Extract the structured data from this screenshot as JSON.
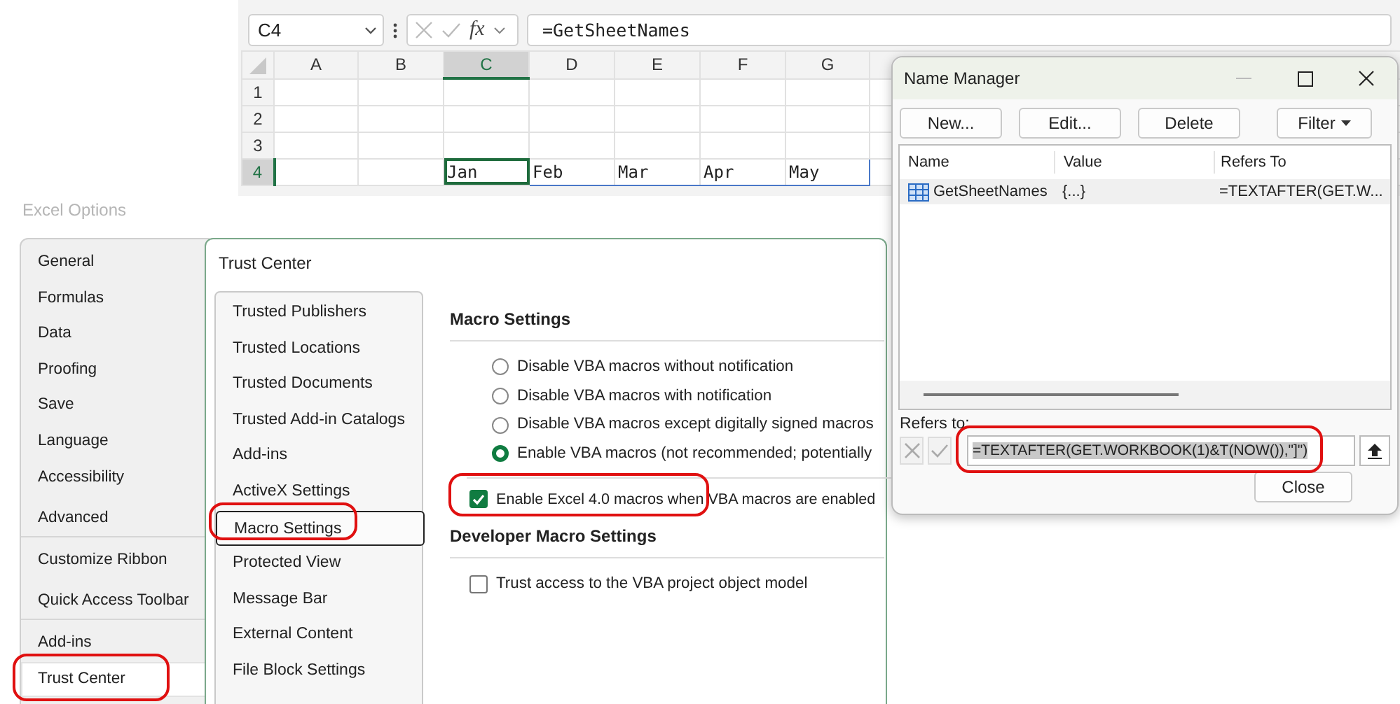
{
  "formula_bar": {
    "name_box": "C4",
    "function_label": "fx",
    "formula": "=GetSheetNames"
  },
  "sheet": {
    "columns": [
      {
        "label": "A",
        "selected": false
      },
      {
        "label": "B",
        "selected": false
      },
      {
        "label": "C",
        "selected": true
      },
      {
        "label": "D",
        "selected": false
      },
      {
        "label": "E",
        "selected": false
      },
      {
        "label": "F",
        "selected": false
      },
      {
        "label": "G",
        "selected": false
      }
    ],
    "rows": [
      {
        "label": "1",
        "selected": false,
        "cells": [
          null,
          null,
          null,
          null,
          null,
          null,
          null
        ]
      },
      {
        "label": "2",
        "selected": false,
        "cells": [
          null,
          null,
          null,
          null,
          null,
          null,
          null
        ]
      },
      {
        "label": "3",
        "selected": false,
        "cells": [
          null,
          null,
          null,
          null,
          null,
          null,
          null
        ]
      },
      {
        "label": "4",
        "selected": true,
        "cells": [
          null,
          null,
          {
            "text": "Jan",
            "active": true
          },
          {
            "text": "Feb",
            "active": false
          },
          {
            "text": "Mar",
            "active": false
          },
          {
            "text": "Apr",
            "active": false
          },
          {
            "text": "May",
            "active": false
          }
        ]
      }
    ]
  },
  "excel_options": {
    "title": "Excel Options",
    "categories": [
      {
        "label": "General",
        "selected": false,
        "highlighted": false,
        "divider_after": false
      },
      {
        "label": "Formulas",
        "selected": false,
        "highlighted": false,
        "divider_after": false
      },
      {
        "label": "Data",
        "selected": false,
        "highlighted": false,
        "divider_after": false
      },
      {
        "label": "Proofing",
        "selected": false,
        "highlighted": false,
        "divider_after": false
      },
      {
        "label": "Save",
        "selected": false,
        "highlighted": false,
        "divider_after": false
      },
      {
        "label": "Language",
        "selected": false,
        "highlighted": false,
        "divider_after": false
      },
      {
        "label": "Accessibility",
        "selected": false,
        "highlighted": false,
        "divider_after": false
      },
      {
        "label": "Advanced",
        "selected": false,
        "highlighted": false,
        "divider_after": true
      },
      {
        "label": "Customize Ribbon",
        "selected": false,
        "highlighted": false,
        "divider_after": false
      },
      {
        "label": "Quick Access Toolbar",
        "selected": false,
        "highlighted": false,
        "divider_after": true
      },
      {
        "label": "Add-ins",
        "selected": false,
        "highlighted": false,
        "divider_after": false
      },
      {
        "label": "Trust Center",
        "selected": true,
        "highlighted": true,
        "divider_after": false
      }
    ]
  },
  "trust_center": {
    "title": "Trust Center",
    "categories": [
      {
        "label": "Trusted Publishers",
        "selected": false,
        "highlighted": false
      },
      {
        "label": "Trusted Locations",
        "selected": false,
        "highlighted": false
      },
      {
        "label": "Trusted Documents",
        "selected": false,
        "highlighted": false
      },
      {
        "label": "Trusted Add-in Catalogs",
        "selected": false,
        "highlighted": false
      },
      {
        "label": "Add-ins",
        "selected": false,
        "highlighted": false
      },
      {
        "label": "ActiveX Settings",
        "selected": false,
        "highlighted": false
      },
      {
        "label": "Macro Settings",
        "selected": true,
        "highlighted": true
      },
      {
        "label": "Protected View",
        "selected": false,
        "highlighted": false
      },
      {
        "label": "Message Bar",
        "selected": false,
        "highlighted": false
      },
      {
        "label": "External Content",
        "selected": false,
        "highlighted": false
      },
      {
        "label": "File Block Settings",
        "selected": false,
        "highlighted": false
      }
    ],
    "macro_settings": {
      "heading": "Macro Settings",
      "options": [
        {
          "label": "Disable VBA macros without notification",
          "selected": false
        },
        {
          "label": "Disable VBA macros with notification",
          "selected": false
        },
        {
          "label": "Disable VBA macros except digitally signed macros",
          "selected": false
        },
        {
          "label": "Enable VBA macros (not recommended; potentially",
          "selected": true
        }
      ],
      "excel4_option": {
        "label": "Enable Excel 4.0 macros when VBA macros are enabled",
        "checked": true,
        "highlighted": true
      }
    },
    "developer_settings": {
      "heading": "Developer Macro Settings",
      "options": [
        {
          "label": "Trust access to the VBA project object model",
          "checked": false
        }
      ]
    }
  },
  "name_manager": {
    "title": "Name Manager",
    "buttons": [
      {
        "label": "New...",
        "kind": "button"
      },
      {
        "label": "Edit...",
        "kind": "button"
      },
      {
        "label": "Delete",
        "kind": "button"
      },
      {
        "label": "Filter",
        "kind": "dropdown"
      }
    ],
    "columns": [
      "Name",
      "Value",
      "Refers To"
    ],
    "rows": [
      {
        "name": "GetSheetNames",
        "value": "{...}",
        "refers_to": "=TEXTAFTER(GET.W...",
        "selected": true
      }
    ],
    "refers_to_label": "Refers to:",
    "refers_to_value": "=TEXTAFTER(GET.WORKBOOK(1)&T(NOW()),\"]\")",
    "refers_to_selected": true,
    "refers_to_highlighted": true,
    "close_button": "Close"
  }
}
